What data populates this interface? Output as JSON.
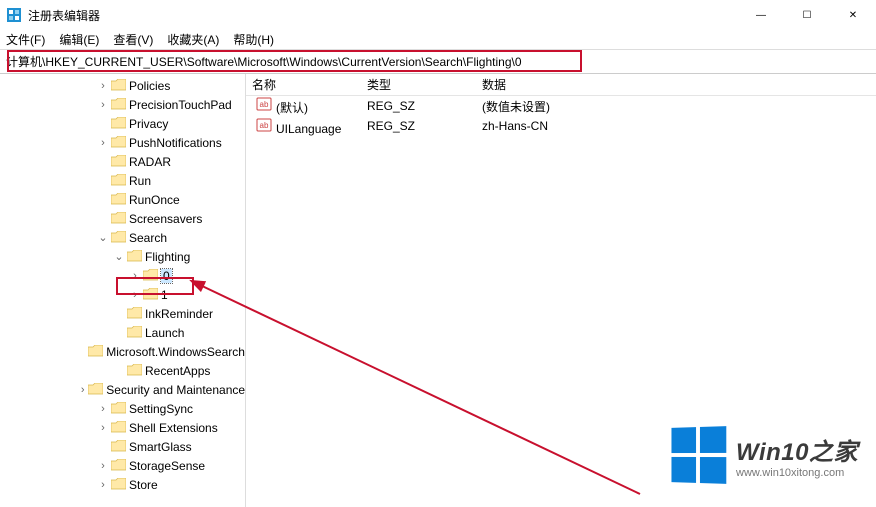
{
  "window": {
    "title": "注册表编辑器",
    "controls": {
      "min": "—",
      "max": "☐",
      "close": "✕"
    }
  },
  "menu": {
    "file": "文件(F)",
    "edit": "编辑(E)",
    "view": "查看(V)",
    "fav": "收藏夹(A)",
    "help": "帮助(H)"
  },
  "address": "计算机\\HKEY_CURRENT_USER\\Software\\Microsoft\\Windows\\CurrentVersion\\Search\\Flighting\\0",
  "tree": [
    {
      "indent": 6,
      "exp": ">",
      "label": "Policies"
    },
    {
      "indent": 6,
      "exp": ">",
      "label": "PrecisionTouchPad"
    },
    {
      "indent": 6,
      "exp": "",
      "label": "Privacy"
    },
    {
      "indent": 6,
      "exp": ">",
      "label": "PushNotifications"
    },
    {
      "indent": 6,
      "exp": "",
      "label": "RADAR"
    },
    {
      "indent": 6,
      "exp": "",
      "label": "Run"
    },
    {
      "indent": 6,
      "exp": "",
      "label": "RunOnce"
    },
    {
      "indent": 6,
      "exp": "",
      "label": "Screensavers"
    },
    {
      "indent": 6,
      "exp": "v",
      "label": "Search"
    },
    {
      "indent": 7,
      "exp": "v",
      "label": "Flighting"
    },
    {
      "indent": 8,
      "exp": ">",
      "label": "0",
      "selected": true
    },
    {
      "indent": 8,
      "exp": ">",
      "label": "1"
    },
    {
      "indent": 7,
      "exp": "",
      "label": "InkReminder"
    },
    {
      "indent": 7,
      "exp": "",
      "label": "Launch"
    },
    {
      "indent": 7,
      "exp": "",
      "label": "Microsoft.WindowsSearch"
    },
    {
      "indent": 7,
      "exp": "",
      "label": "RecentApps"
    },
    {
      "indent": 6,
      "exp": ">",
      "label": "Security and Maintenance"
    },
    {
      "indent": 6,
      "exp": ">",
      "label": "SettingSync"
    },
    {
      "indent": 6,
      "exp": ">",
      "label": "Shell Extensions"
    },
    {
      "indent": 6,
      "exp": "",
      "label": "SmartGlass"
    },
    {
      "indent": 6,
      "exp": ">",
      "label": "StorageSense"
    },
    {
      "indent": 6,
      "exp": ">",
      "label": "Store"
    }
  ],
  "list": {
    "headers": {
      "name": "名称",
      "type": "类型",
      "data": "数据"
    },
    "rows": [
      {
        "name": "(默认)",
        "type": "REG_SZ",
        "data": "(数值未设置)"
      },
      {
        "name": "UILanguage",
        "type": "REG_SZ",
        "data": "zh-Hans-CN"
      }
    ]
  },
  "watermark": {
    "title": "Win10之家",
    "url": "www.win10xitong.com"
  }
}
